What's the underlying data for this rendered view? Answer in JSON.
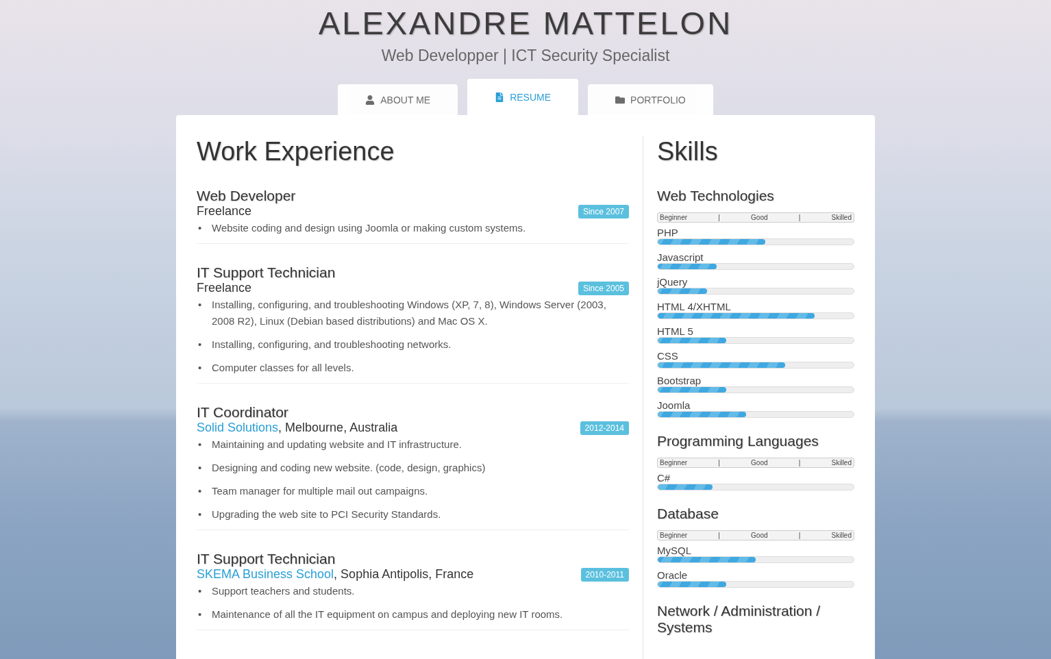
{
  "header": {
    "name": "ALEXANDRE MATTELON",
    "tagline": "Web Developper | ICT Security Specialist"
  },
  "tabs": [
    {
      "label": "ABOUT ME",
      "selected": false
    },
    {
      "label": "RESUME",
      "selected": true
    },
    {
      "label": "PORTFOLIO",
      "selected": false
    }
  ],
  "work": {
    "title": "Work Experience",
    "bullet": "•",
    "jobs": [
      {
        "role": "Web Developer",
        "organization": "Freelance",
        "link": false,
        "badge": "Since 2007",
        "duties": [
          "Website coding and design using Joomla or making custom systems."
        ]
      },
      {
        "role": "IT Support Technician",
        "organization": "Freelance",
        "link": false,
        "badge": "Since 2005",
        "duties": [
          "Installing, configuring, and troubleshooting Windows (XP, 7, 8), Windows Server (2003, 2008 R2), Linux (Debian based distributions) and Mac OS X.",
          "Installing, configuring, and troubleshooting networks.",
          "Computer classes for all levels."
        ]
      },
      {
        "role": "IT Coordinator",
        "organization": "Solid Solutions",
        "link": true,
        "location": ", Melbourne, Australia",
        "badge": "2012-2014",
        "duties": [
          "Maintaining and updating website and IT infrastructure.",
          "Designing and coding new website. (code, design, graphics)",
          "Team manager for multiple mail out campaigns.",
          "Upgrading the web site to PCI Security Standards."
        ]
      },
      {
        "role": "IT Support Technician",
        "organization": "SKEMA Business School",
        "link": true,
        "location": ", Sophia Antipolis, France",
        "badge": "2010-2011",
        "duties": [
          "Support teachers and students.",
          "Maintenance of all the IT equipment on campus and deploying new IT rooms."
        ]
      }
    ]
  },
  "skills": {
    "title": "Skills",
    "categories": [
      {
        "name": "Web Technologies",
        "scale": [
          "Beginner",
          "|",
          "Good",
          "|",
          "Skilled"
        ],
        "items": [
          {
            "name": "PHP",
            "level": 0.55
          },
          {
            "name": "Javascript",
            "level": 0.3
          },
          {
            "name": "jQuery",
            "level": 0.25
          },
          {
            "name": "HTML 4/XHTML",
            "level": 0.8
          },
          {
            "name": "HTML 5",
            "level": 0.35
          },
          {
            "name": "CSS",
            "level": 0.65
          },
          {
            "name": "Bootstrap",
            "level": 0.35
          },
          {
            "name": "Joomla",
            "level": 0.45
          }
        ]
      },
      {
        "name": "Programming Languages",
        "scale": [
          "Beginner",
          "|",
          "Good",
          "|",
          "Skilled"
        ],
        "items": [
          {
            "name": "C#",
            "level": 0.28
          }
        ]
      },
      {
        "name": "Database",
        "scale": [
          "Beginner",
          "|",
          "Good",
          "|",
          "Skilled"
        ],
        "items": [
          {
            "name": "MySQL",
            "level": 0.5
          },
          {
            "name": "Oracle",
            "level": 0.35
          }
        ]
      },
      {
        "name": "Network / Administration / Systems"
      }
    ]
  }
}
